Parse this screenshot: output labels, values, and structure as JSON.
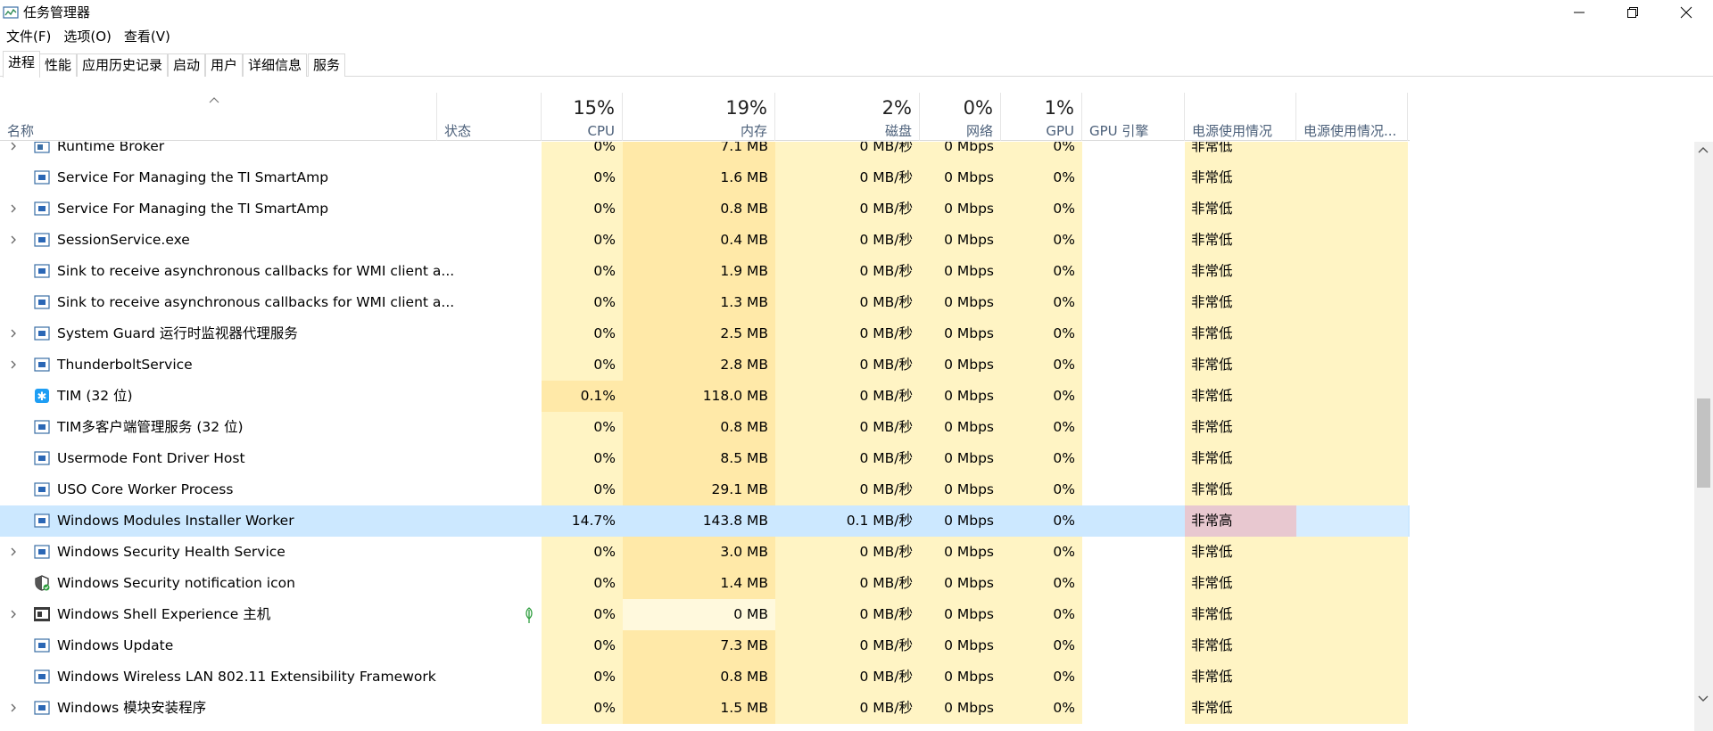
{
  "window": {
    "title": "任务管理器",
    "icons": {
      "app": "task-manager-icon",
      "minimize": "minimize-icon",
      "maximize": "restore-icon",
      "close": "close-icon"
    }
  },
  "menu": [
    "文件(F)",
    "选项(O)",
    "查看(V)"
  ],
  "tabs": [
    "进程",
    "性能",
    "应用历史记录",
    "启动",
    "用户",
    "详细信息",
    "服务"
  ],
  "active_tab": "进程",
  "columns": {
    "name": "名称",
    "status": "状态",
    "cpu": {
      "pct": "15%",
      "label": "CPU"
    },
    "memory": {
      "pct": "19%",
      "label": "内存"
    },
    "disk": {
      "pct": "2%",
      "label": "磁盘"
    },
    "network": {
      "pct": "0%",
      "label": "网络"
    },
    "gpu": {
      "pct": "1%",
      "label": "GPU"
    },
    "gpu_engine": "GPU 引擎",
    "power": "电源使用情况",
    "power_trend": "电源使用情况..."
  },
  "colors": {
    "heat_light": "#fff4c4",
    "heat_mid": "#ffe9a8",
    "heat_low": "#fff9dd",
    "selected_row": "#cce8ff",
    "power_high": "#e8c8d0",
    "header_label": "#4c607a"
  },
  "processes": [
    {
      "name": "Runtime Broker",
      "expandable": true,
      "icon": "window-process-icon",
      "cpu": "0%",
      "memory": "7.1 MB",
      "disk": "0 MB/秒",
      "network": "0 Mbps",
      "gpu": "0%",
      "power": "非常低"
    },
    {
      "name": "Service For Managing the TI SmartAmp",
      "expandable": false,
      "icon": "service-icon",
      "cpu": "0%",
      "memory": "1.6 MB",
      "disk": "0 MB/秒",
      "network": "0 Mbps",
      "gpu": "0%",
      "power": "非常低"
    },
    {
      "name": "Service For Managing the TI SmartAmp",
      "expandable": true,
      "icon": "service-icon",
      "cpu": "0%",
      "memory": "0.8 MB",
      "disk": "0 MB/秒",
      "network": "0 Mbps",
      "gpu": "0%",
      "power": "非常低"
    },
    {
      "name": "SessionService.exe",
      "expandable": true,
      "icon": "service-icon",
      "cpu": "0%",
      "memory": "0.4 MB",
      "disk": "0 MB/秒",
      "network": "0 Mbps",
      "gpu": "0%",
      "power": "非常低"
    },
    {
      "name": "Sink to receive asynchronous callbacks for WMI client a...",
      "expandable": false,
      "icon": "service-icon",
      "cpu": "0%",
      "memory": "1.9 MB",
      "disk": "0 MB/秒",
      "network": "0 Mbps",
      "gpu": "0%",
      "power": "非常低"
    },
    {
      "name": "Sink to receive asynchronous callbacks for WMI client a...",
      "expandable": false,
      "icon": "service-icon",
      "cpu": "0%",
      "memory": "1.3 MB",
      "disk": "0 MB/秒",
      "network": "0 Mbps",
      "gpu": "0%",
      "power": "非常低"
    },
    {
      "name": "System Guard 运行时监视器代理服务",
      "expandable": true,
      "icon": "service-icon",
      "cpu": "0%",
      "memory": "2.5 MB",
      "disk": "0 MB/秒",
      "network": "0 Mbps",
      "gpu": "0%",
      "power": "非常低"
    },
    {
      "name": "ThunderboltService",
      "expandable": true,
      "icon": "service-icon",
      "cpu": "0%",
      "memory": "2.8 MB",
      "disk": "0 MB/秒",
      "network": "0 Mbps",
      "gpu": "0%",
      "power": "非常低"
    },
    {
      "name": "TIM (32 位)",
      "expandable": false,
      "icon": "tim-star-icon",
      "cpu": "0.1%",
      "memory": "118.0 MB",
      "disk": "0 MB/秒",
      "network": "0 Mbps",
      "gpu": "0%",
      "power": "非常低"
    },
    {
      "name": "TIM多客户端管理服务 (32 位)",
      "expandable": false,
      "icon": "service-icon",
      "cpu": "0%",
      "memory": "0.8 MB",
      "disk": "0 MB/秒",
      "network": "0 Mbps",
      "gpu": "0%",
      "power": "非常低"
    },
    {
      "name": "Usermode Font Driver Host",
      "expandable": false,
      "icon": "service-icon",
      "cpu": "0%",
      "memory": "8.5 MB",
      "disk": "0 MB/秒",
      "network": "0 Mbps",
      "gpu": "0%",
      "power": "非常低"
    },
    {
      "name": "USO Core Worker Process",
      "expandable": false,
      "icon": "service-icon",
      "cpu": "0%",
      "memory": "29.1 MB",
      "disk": "0 MB/秒",
      "network": "0 Mbps",
      "gpu": "0%",
      "power": "非常低"
    },
    {
      "name": "Windows Modules Installer Worker",
      "expandable": false,
      "icon": "service-icon",
      "cpu": "14.7%",
      "memory": "143.8 MB",
      "disk": "0.1 MB/秒",
      "network": "0 Mbps",
      "gpu": "0%",
      "power": "非常高",
      "selected": true
    },
    {
      "name": "Windows Security Health Service",
      "expandable": true,
      "icon": "service-icon",
      "cpu": "0%",
      "memory": "3.0 MB",
      "disk": "0 MB/秒",
      "network": "0 Mbps",
      "gpu": "0%",
      "power": "非常低"
    },
    {
      "name": "Windows Security notification icon",
      "expandable": false,
      "icon": "shield-check-icon",
      "cpu": "0%",
      "memory": "1.4 MB",
      "disk": "0 MB/秒",
      "network": "0 Mbps",
      "gpu": "0%",
      "power": "非常低"
    },
    {
      "name": "Windows Shell Experience 主机",
      "expandable": true,
      "icon": "shell-experience-icon",
      "status_icon": "leaf-suspended-icon",
      "cpu": "0%",
      "memory": "0 MB",
      "disk": "0 MB/秒",
      "network": "0 Mbps",
      "gpu": "0%",
      "power": "非常低"
    },
    {
      "name": "Windows Update",
      "expandable": false,
      "icon": "service-icon",
      "cpu": "0%",
      "memory": "7.3 MB",
      "disk": "0 MB/秒",
      "network": "0 Mbps",
      "gpu": "0%",
      "power": "非常低"
    },
    {
      "name": "Windows Wireless LAN 802.11 Extensibility Framework",
      "expandable": false,
      "icon": "service-icon",
      "cpu": "0%",
      "memory": "0.8 MB",
      "disk": "0 MB/秒",
      "network": "0 Mbps",
      "gpu": "0%",
      "power": "非常低"
    },
    {
      "name": "Windows 模块安装程序",
      "expandable": true,
      "icon": "service-icon",
      "cpu": "0%",
      "memory": "1.5 MB",
      "disk": "0 MB/秒",
      "network": "0 Mbps",
      "gpu": "0%",
      "power": "非常低"
    }
  ]
}
